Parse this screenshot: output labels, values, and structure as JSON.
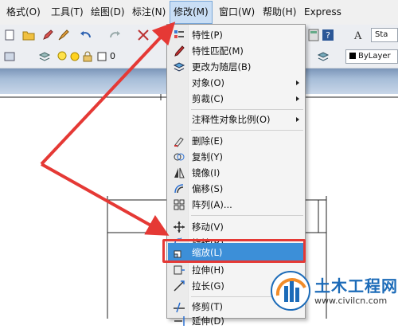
{
  "menubar": {
    "items": [
      {
        "label": "格式(O)"
      },
      {
        "label": "工具(T)"
      },
      {
        "label": "绘图(D)"
      },
      {
        "label": "标注(N)"
      },
      {
        "label": "修改(M)",
        "active": true
      },
      {
        "label": "窗口(W)"
      },
      {
        "label": "帮助(H)"
      },
      {
        "label": "Express"
      }
    ]
  },
  "toolbar": {
    "text_style_value": "Sta",
    "layer_value": "0",
    "color_value": "ByLayer"
  },
  "modify_menu": {
    "items": [
      {
        "label": "特性(P)",
        "icon": "properties-icon"
      },
      {
        "label": "特性匹配(M)",
        "icon": "match-properties-icon"
      },
      {
        "label": "更改为随层(B)",
        "icon": "set-bylayer-icon"
      },
      {
        "label": "对象(O)",
        "submenu": true
      },
      {
        "label": "剪裁(C)",
        "submenu": true
      },
      {
        "label": "注释性对象比例(O)",
        "submenu": true
      },
      {
        "label": "删除(E)",
        "icon": "erase-icon"
      },
      {
        "label": "复制(Y)",
        "icon": "copy-icon"
      },
      {
        "label": "镜像(I)",
        "icon": "mirror-icon"
      },
      {
        "label": "偏移(S)",
        "icon": "offset-icon"
      },
      {
        "label": "阵列(A)...",
        "icon": "array-icon"
      },
      {
        "label": "移动(V)",
        "icon": "move-icon"
      },
      {
        "label": "旋转(R)",
        "icon": "rotate-icon"
      },
      {
        "label": "缩放(L)",
        "icon": "scale-icon",
        "highlighted": true
      },
      {
        "label": "拉伸(H)",
        "icon": "stretch-icon"
      },
      {
        "label": "拉长(G)",
        "icon": "lengthen-icon"
      },
      {
        "label": "修剪(T)",
        "icon": "trim-icon"
      },
      {
        "label": "延伸(D)",
        "icon": "extend-icon"
      }
    ]
  },
  "watermark": {
    "title": "土木工程网",
    "url": "www.civilcn.com"
  },
  "colors": {
    "highlight": "#3c8fd8",
    "annotation_red": "#e53935",
    "menu_bg": "#f4f4f4"
  }
}
